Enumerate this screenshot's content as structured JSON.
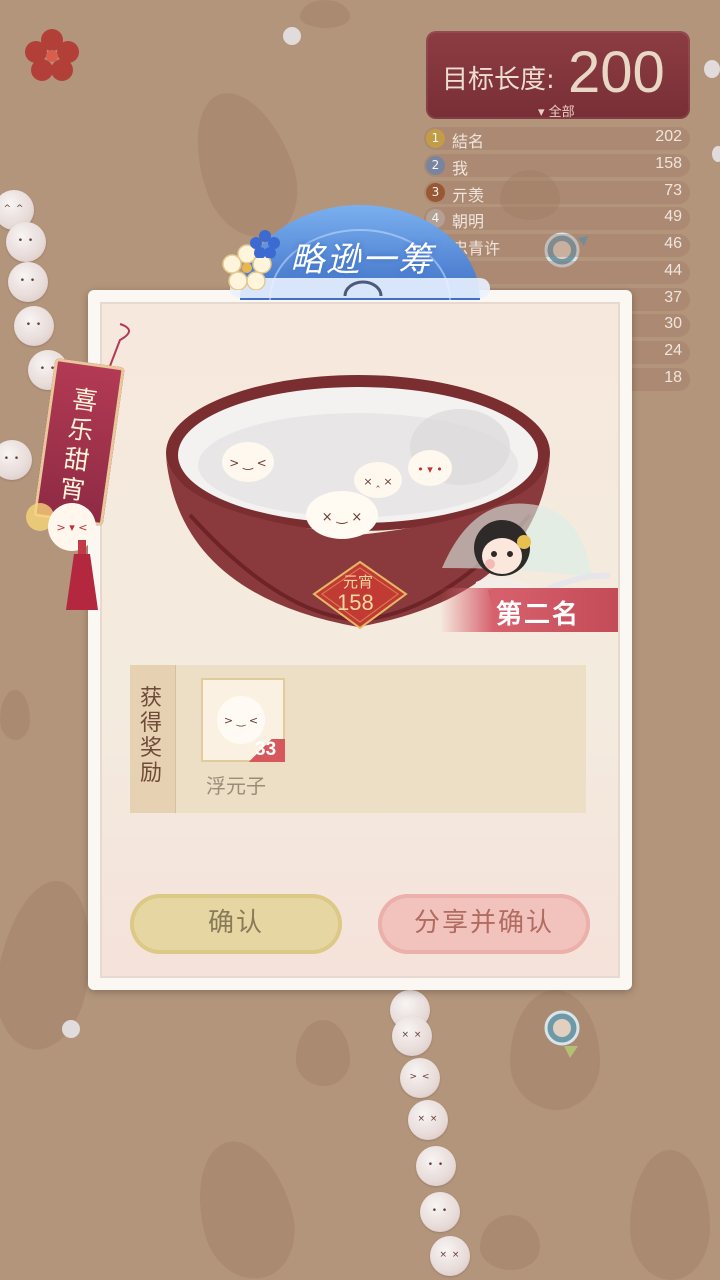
{
  "target": {
    "label": "目标长度:",
    "value": "200",
    "filter_label": "全部"
  },
  "leaderboard": [
    {
      "rank": "1",
      "name": "結名",
      "score": "202"
    },
    {
      "rank": "2",
      "name": "我",
      "score": "158"
    },
    {
      "rank": "3",
      "name": "亓羡",
      "score": "73"
    },
    {
      "rank": "4",
      "name": "朝明",
      "score": "49"
    },
    {
      "rank": "",
      "name": "忠青许",
      "score": "46"
    },
    {
      "rank": "",
      "name": "",
      "score": "44"
    },
    {
      "rank": "",
      "name": "",
      "score": "37"
    },
    {
      "rank": "",
      "name": "",
      "score": "30"
    },
    {
      "rank": "",
      "name": "",
      "score": "24"
    },
    {
      "rank": "",
      "name": "",
      "score": "18"
    }
  ],
  "event_tag": "喜乐甜宵",
  "result": {
    "banner_title": "略逊一筹",
    "score_label": "元宵",
    "score_value": "158",
    "rank_label": "第二名"
  },
  "reward": {
    "title": "获得奖励",
    "item_name": "浮元子",
    "item_count": "33"
  },
  "buttons": {
    "confirm": "确认",
    "share_confirm": "分享并确认"
  },
  "colors": {
    "background": "#b89a80",
    "panel": "#fbf7f2",
    "target_panel": "#7a2e37",
    "confirm_button": "#e6d7a2",
    "share_button": "#f2c3bd",
    "rank_ribbon": "#c44b58"
  }
}
